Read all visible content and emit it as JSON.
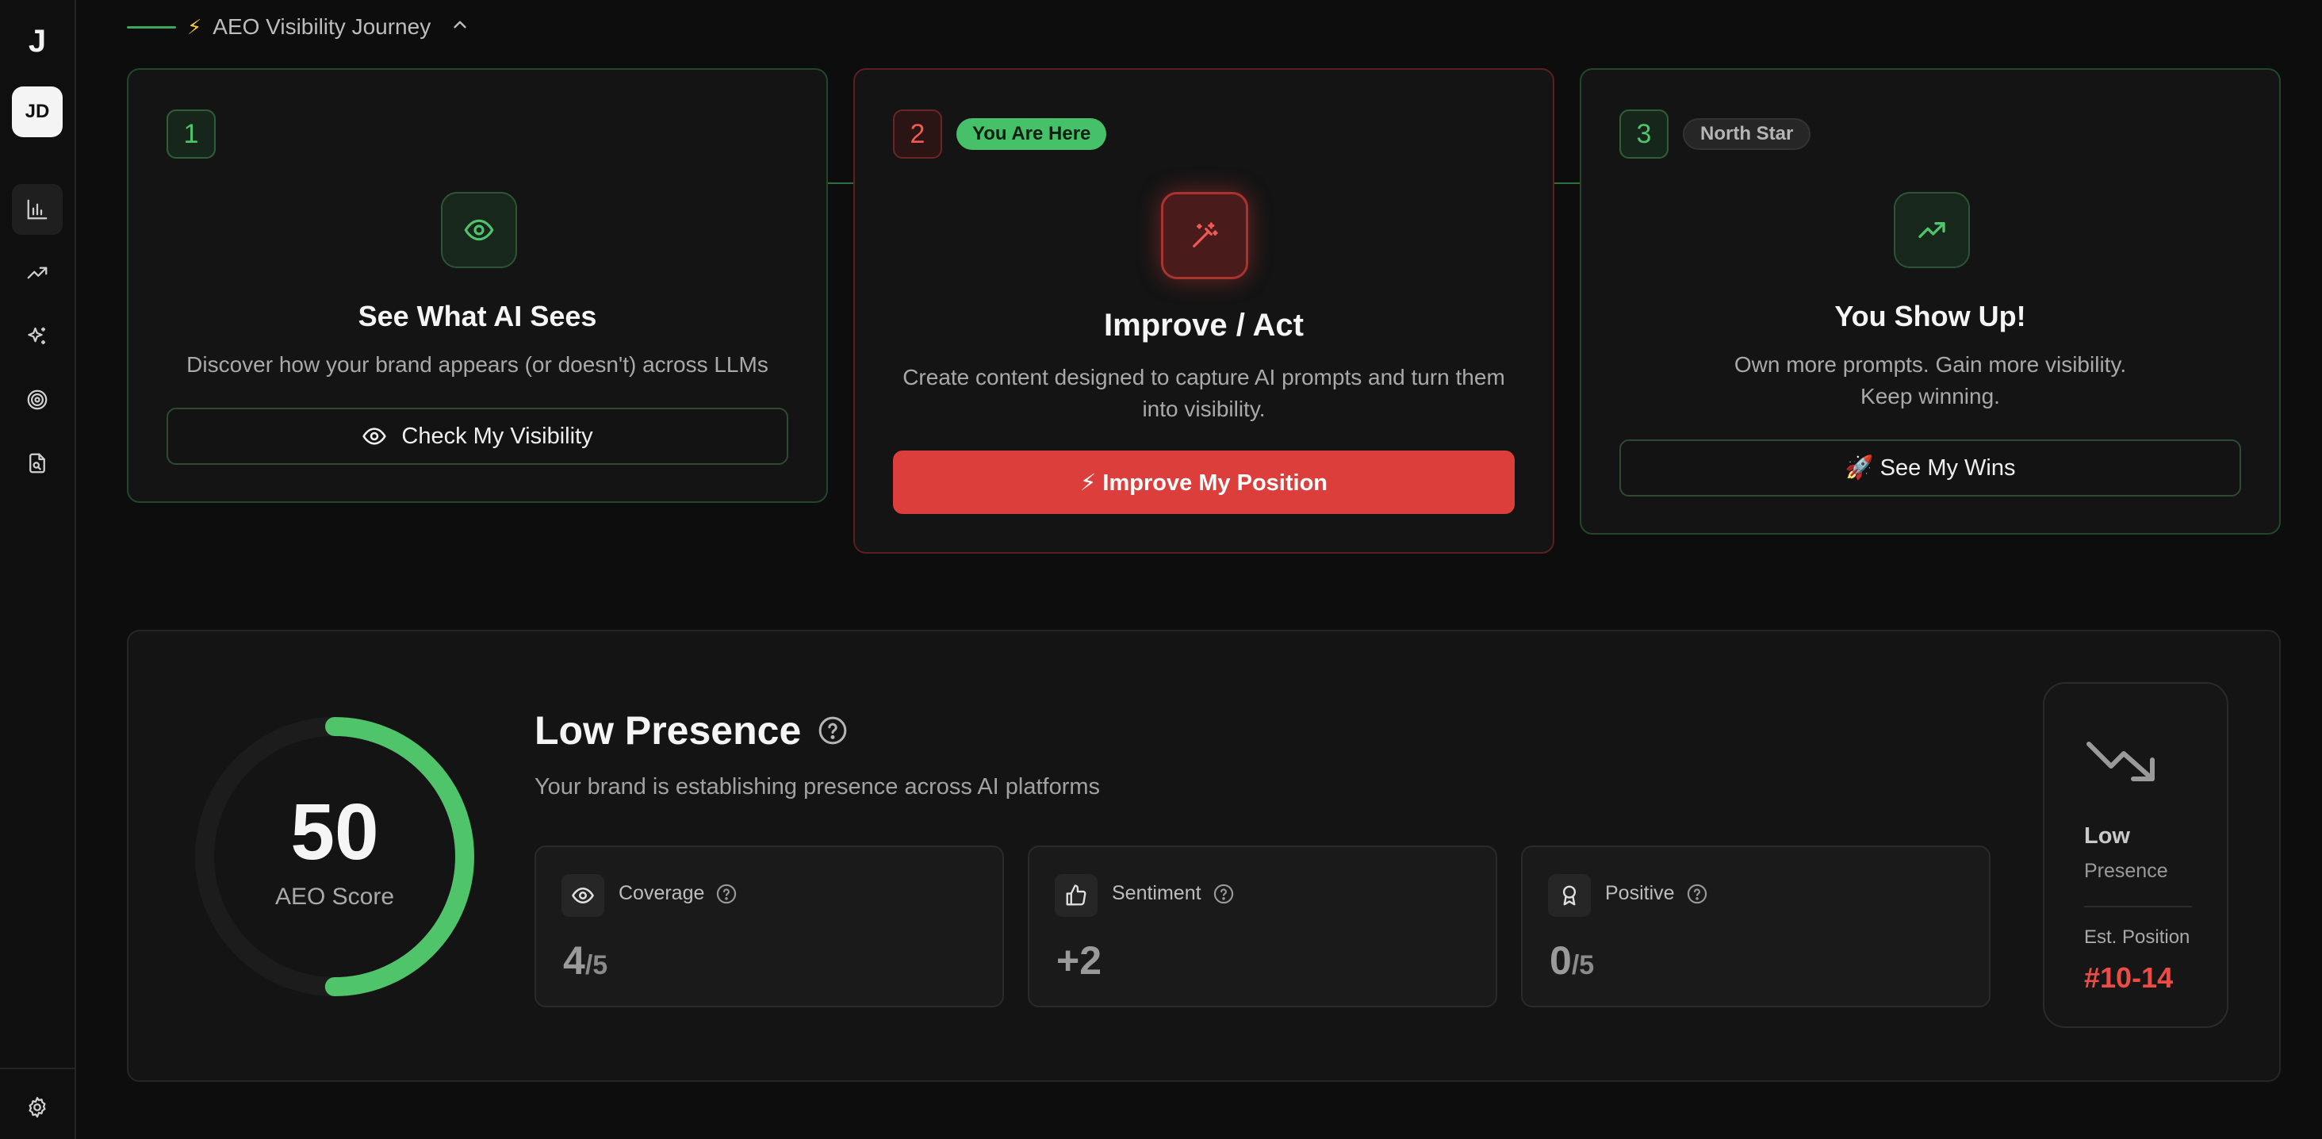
{
  "sidebar": {
    "logo": "J",
    "avatar_initials": "JD",
    "nav": [
      {
        "name": "analytics-icon",
        "active": true
      },
      {
        "name": "trending-up-icon",
        "active": false
      },
      {
        "name": "sparkles-icon",
        "active": false
      },
      {
        "name": "target-icon",
        "active": false
      },
      {
        "name": "file-search-icon",
        "active": false
      }
    ],
    "settings_icon": "gear-icon"
  },
  "journey": {
    "title": "AEO Visibility Journey",
    "bolt": "⚡"
  },
  "steps": [
    {
      "number": "1",
      "badge": "",
      "icon": "eye-icon",
      "title": "See What AI Sees",
      "description": "Discover how your brand appears (or doesn't) across LLMs",
      "button": "Check My Visibility",
      "button_icon": "eye-icon"
    },
    {
      "number": "2",
      "badge": "You Are Here",
      "icon": "magic-wand-icon",
      "title": "Improve / Act",
      "description": "Create content designed to capture AI prompts and turn them into visibility.",
      "button": "⚡ Improve My Position"
    },
    {
      "number": "3",
      "badge": "North Star",
      "icon": "trending-up-icon",
      "title": "You Show Up!",
      "description": "Own more prompts. Gain more visibility. Keep winning.",
      "button": "🚀 See My Wins"
    }
  ],
  "score": {
    "value": "50",
    "label": "AEO Score",
    "fraction": 0.5,
    "colors": {
      "accent": "#4fc46b",
      "track": "#1c1c1c",
      "danger": "#ea4c46"
    },
    "title": "Low Presence",
    "subtitle": "Your brand is establishing presence across AI platforms",
    "metrics": [
      {
        "label": "Coverage",
        "icon": "eye-icon",
        "value": "4",
        "denom": "/5"
      },
      {
        "label": "Sentiment",
        "icon": "thumbs-up-icon",
        "value": "+2",
        "denom": ""
      },
      {
        "label": "Positive",
        "icon": "award-icon",
        "value": "0",
        "denom": "/5"
      }
    ],
    "side": {
      "icon": "trending-down-icon",
      "level": "Low",
      "level_sub": "Presence",
      "est_label": "Est. Position",
      "est_value": "#10-14"
    }
  }
}
